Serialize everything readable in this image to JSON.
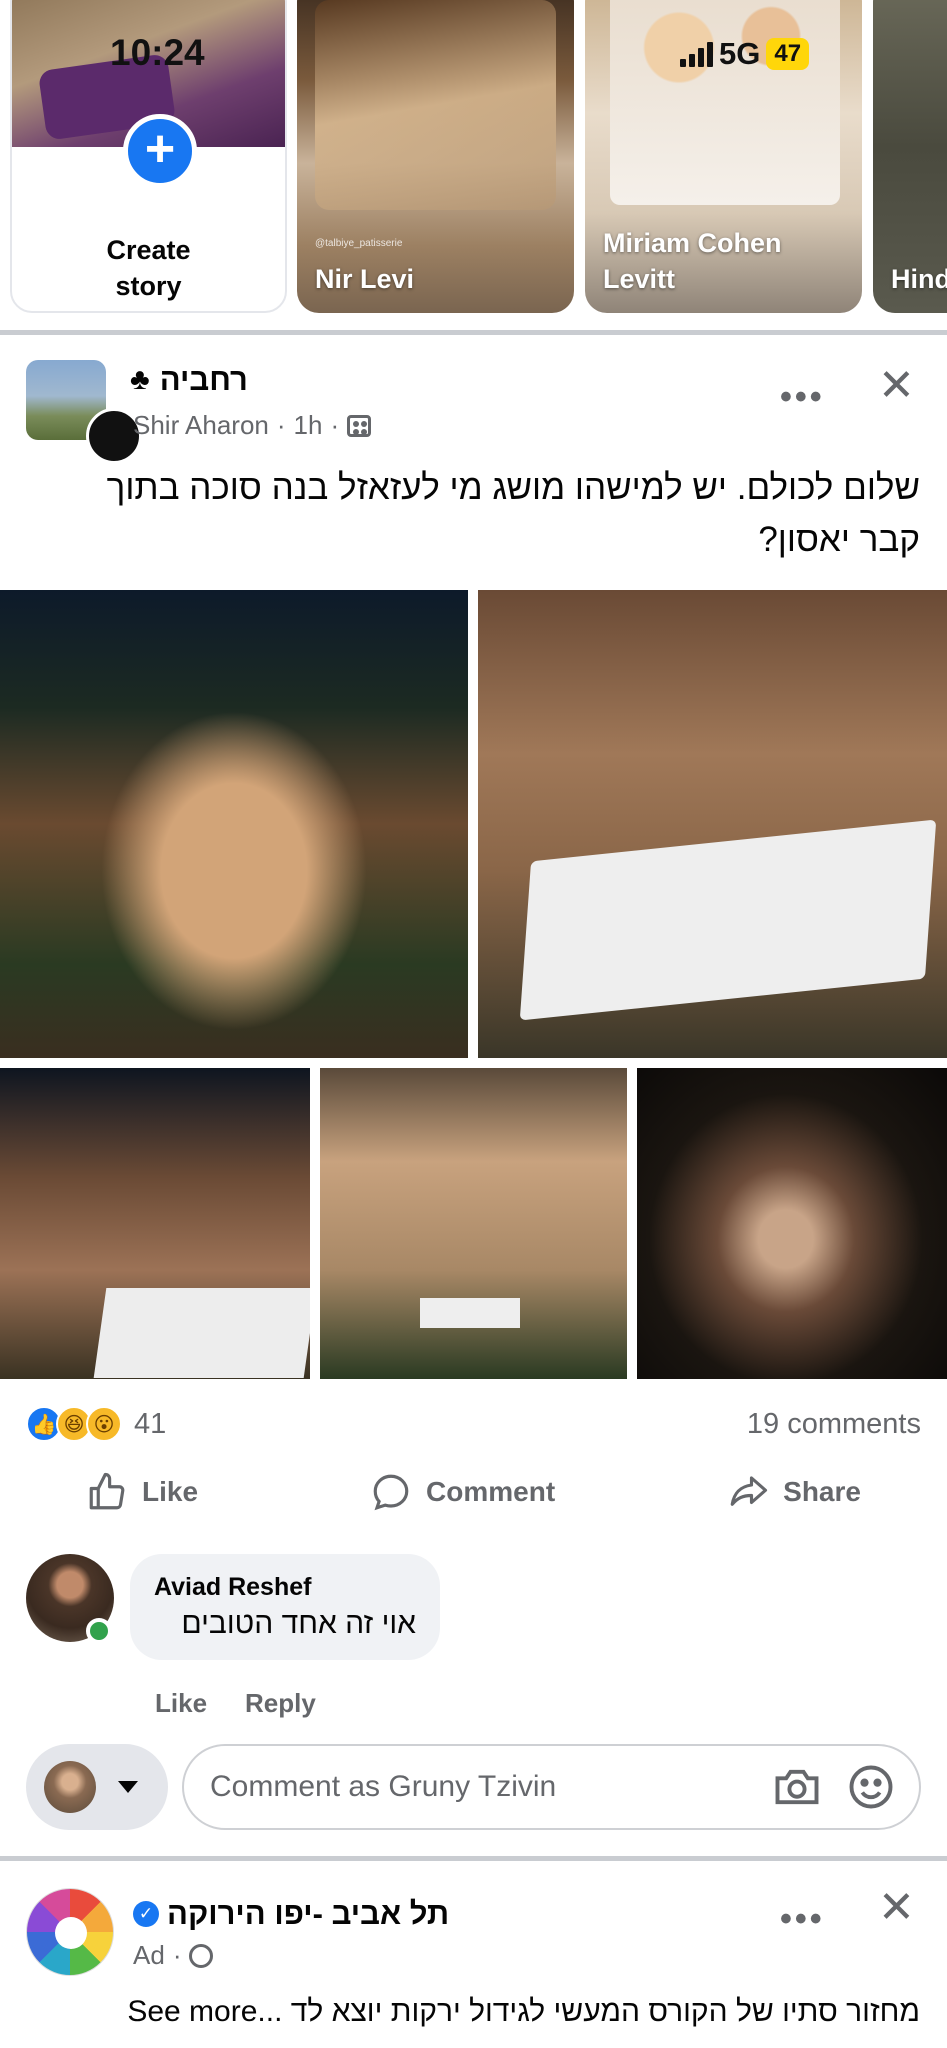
{
  "status_bar": {
    "time": "10:24",
    "network": "5G",
    "battery": "47"
  },
  "stories": {
    "create": {
      "label_line1": "Create",
      "label_line2": "story"
    },
    "items": [
      {
        "name": "Nir Levi",
        "tag": "@talbiye_patisserie"
      },
      {
        "name": "Miriam Cohen Levitt"
      },
      {
        "name": "Hind"
      }
    ]
  },
  "post": {
    "group_name": "רחביה",
    "author": "Shir Aharon",
    "time": "1h",
    "separator": "·",
    "text": "שלום לכולם. יש למישהו מושג מי לעזאזל בנה סוכה בתוך קבר יאסון?",
    "reaction_count": "41",
    "comments_count": "19 comments",
    "actions": {
      "like": "Like",
      "comment": "Comment",
      "share": "Share"
    },
    "more": "•••",
    "close": "✕"
  },
  "comment": {
    "author": "Aviad Reshef",
    "text": "אוי זה אחד הטובים",
    "like": "Like",
    "reply": "Reply"
  },
  "composer": {
    "placeholder": "Comment as Gruny Tzivin"
  },
  "ad": {
    "name": "תל אביב -יפו הירוקה",
    "label": "Ad",
    "text": "מחזור סתיו של הקורס המעשי לגידול ירקות יוצא לד ...See more"
  },
  "colors": {
    "accent": "#1877f2",
    "secondary_text": "#65676b",
    "online": "#31a24c"
  }
}
